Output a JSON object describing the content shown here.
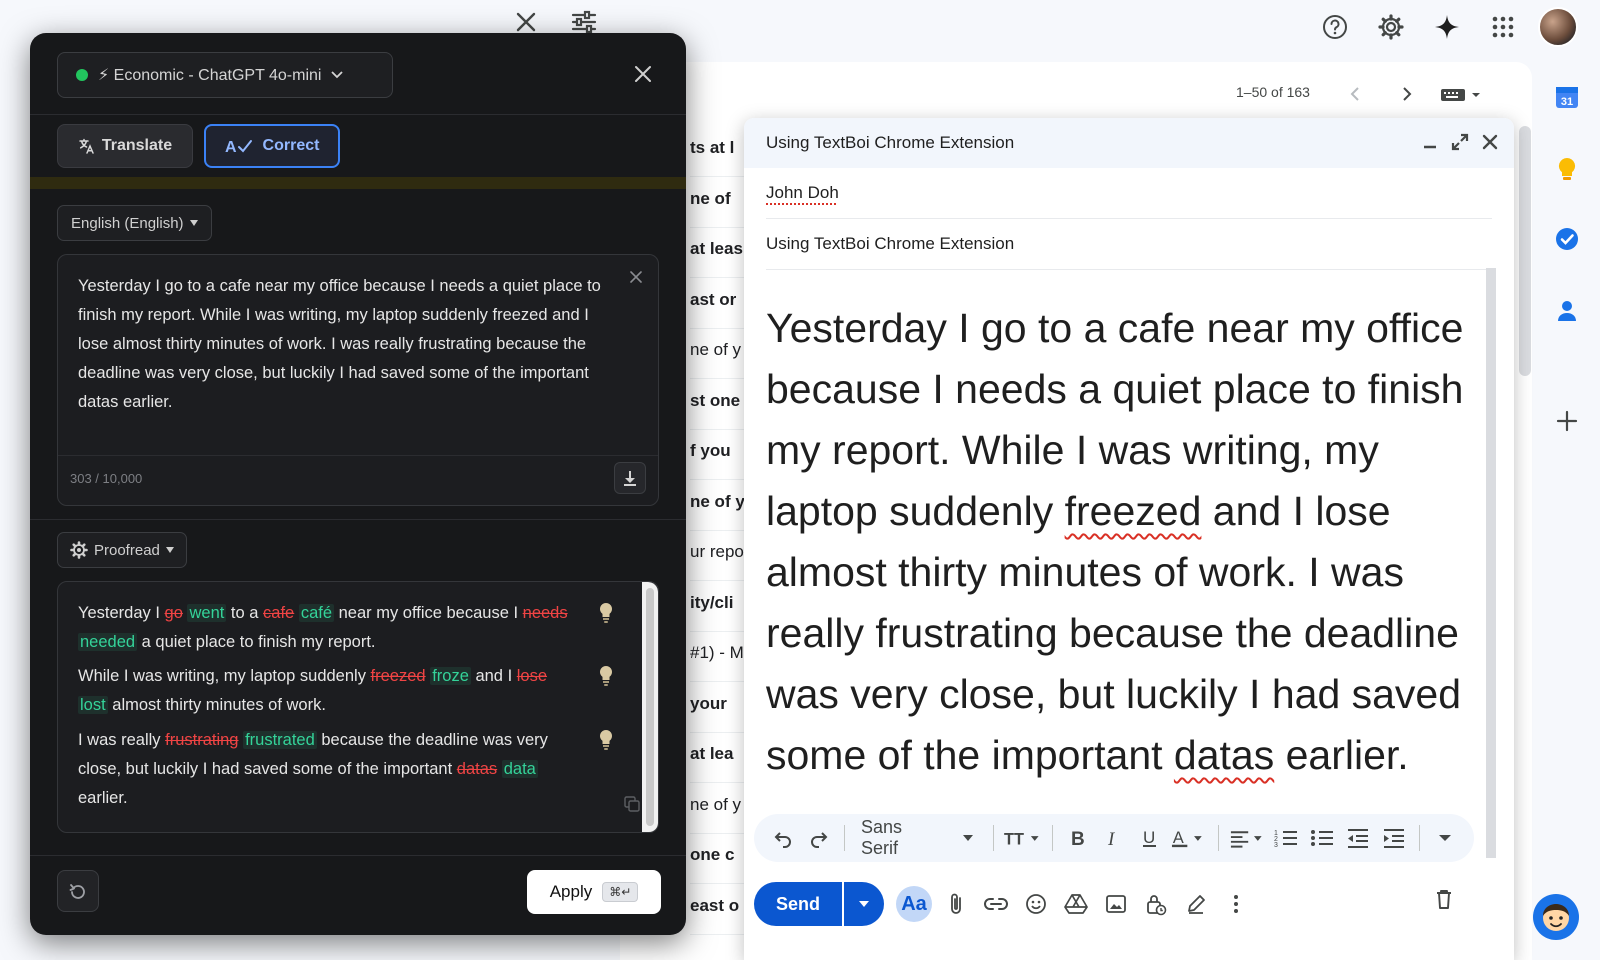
{
  "gmail": {
    "pager": "1–50 of 163",
    "list_fragments": [
      "ts at l",
      "ne of",
      "at leas",
      "ast or",
      "ne of y",
      "st one",
      "f you",
      "ne of y",
      "ur repo",
      "ity/cli",
      "#1) - M",
      "your",
      "at lea",
      "ne of y",
      "one c",
      "east o"
    ],
    "bold_fragments": [
      true,
      true,
      true,
      true,
      false,
      true,
      true,
      true,
      false,
      true,
      false,
      true,
      true,
      false,
      true,
      true
    ]
  },
  "compose": {
    "title": "Using TextBoi Chrome Extension",
    "to": "John Doh",
    "subject": "Using TextBoi Chrome Extension",
    "body": {
      "p1": "Yesterday I go to a cafe near my office because I needs a quiet place to finish my report. While I was writing, my laptop suddenly ",
      "w1": "freezed",
      "p2": " and I lose almost thirty minutes of work. I was really frustrating because the deadline was very close, but luckily I had saved some of the important ",
      "w2": "datas",
      "p3": " earlier."
    },
    "font_name": "Sans Serif",
    "send_label": "Send",
    "aa_label": "Aa"
  },
  "textboi": {
    "model": "⚡ Economic - ChatGPT 4o-mini",
    "translate_label": "Translate",
    "correct_label": "Correct",
    "language": "English (English)",
    "source_text": "Yesterday I go to a cafe near my office because I needs a quiet place to finish my report. While I was writing, my laptop suddenly freezed and I lose almost thirty minutes of work. I was really frustrating because the deadline was very close, but luckily I had saved some of the important datas earlier.",
    "counter": "303 / 10,000",
    "proofread_label": "Proofread",
    "sentences": [
      {
        "a": "Yesterday I ",
        "d1": "go",
        "i1": "went",
        "b": " to a ",
        "d2": "cafe",
        "i2": "café",
        "c": " near my office because I ",
        "d3": "needs",
        "i3": "needed",
        "e": " a quiet place to finish my report."
      },
      {
        "a": "While I was writing, my laptop suddenly ",
        "d1": "freezed",
        "i1": "froze",
        "b": " and I ",
        "d2": "lose",
        "i2": "lost",
        "c": " almost thirty minutes of work."
      },
      {
        "a": "I was really ",
        "d1": "frustrating",
        "i1": "frustrated",
        "b": " because the deadline was very close, but luckily I had saved some of the important ",
        "d2": "datas",
        "i2": "data",
        "c": " earlier."
      }
    ],
    "apply_label": "Apply",
    "apply_shortcut": "⌘↵"
  },
  "colors": {
    "accent_blue": "#3b82f6",
    "status_green": "#22c55e",
    "deleted_red": "#ef4444",
    "inserted_green": "#34d399",
    "gmail_send": "#0b57d0"
  }
}
